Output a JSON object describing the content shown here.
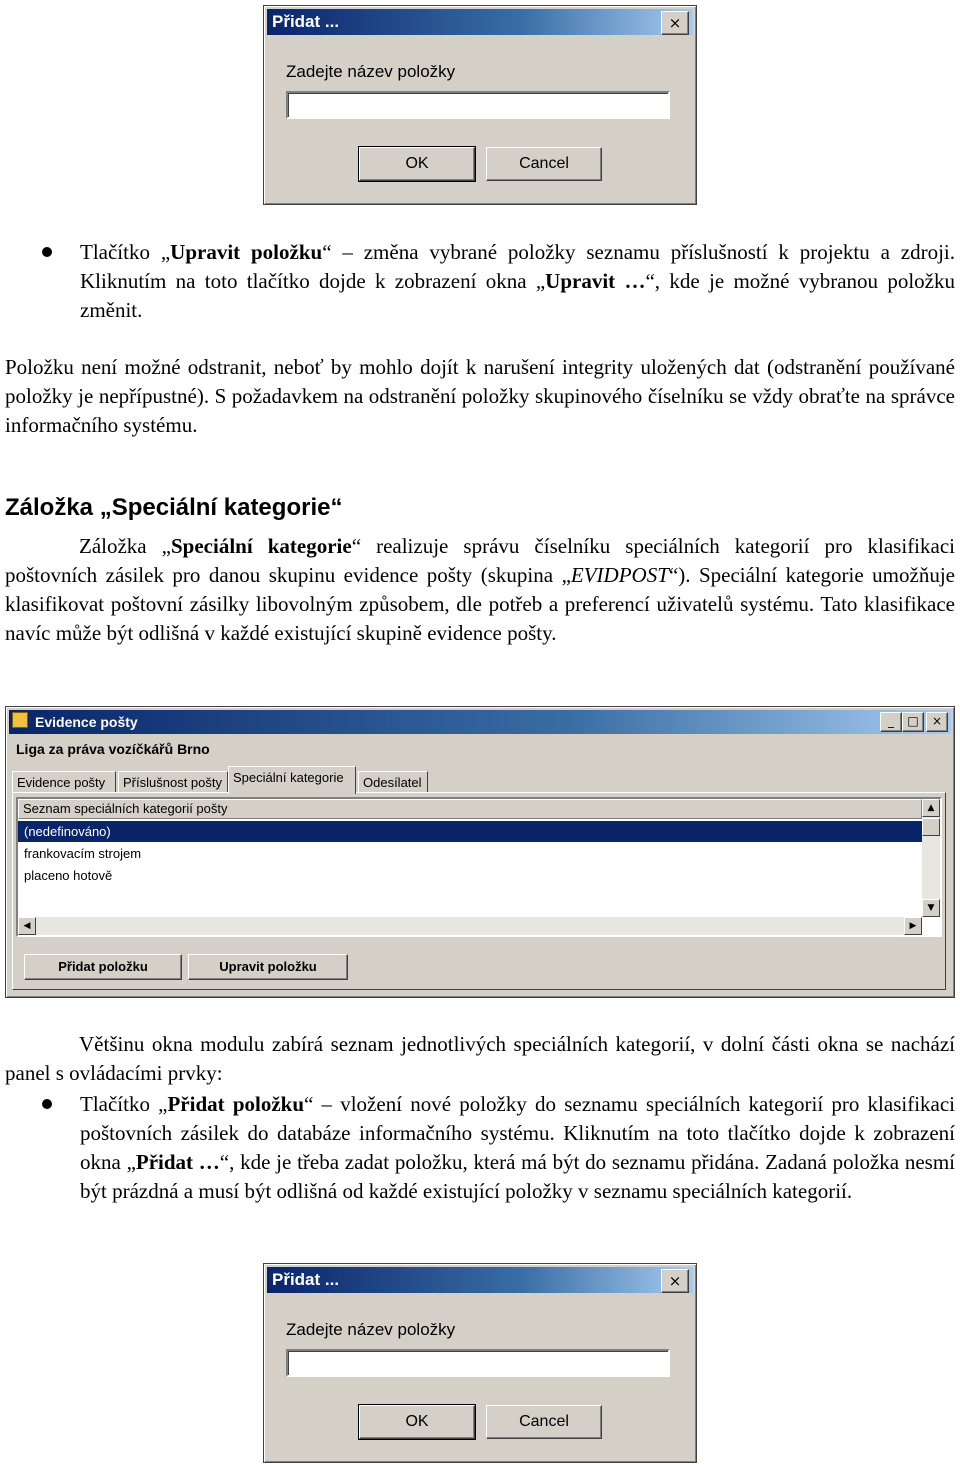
{
  "dialog_top": {
    "title": "Přidat ...",
    "prompt": "Zadejte název položky",
    "ok": "OK",
    "cancel": "Cancel",
    "close": "×"
  },
  "bullet1": {
    "pre": "Tlačítko „",
    "bold": "Upravit položku",
    "post": "“ – změna vybrané položky seznamu příslušností k projektu a zdroji. Kliknutím na toto tlačítko dojde k zobrazení okna „",
    "bold2": "Upravit …",
    "post2": "“, kde je možné vybranou položku změnit."
  },
  "para1": "Položku není možné odstranit, neboť by mohlo dojít k narušení integrity uložených dat (odstranění používané položky je nepřípustné). S požadavkem na odstranění položky skupinového číselníku se vždy obraťte na správce informačního systému.",
  "heading": "Záložka „Speciální kategorie“",
  "para2": {
    "pre": "Záložka „",
    "bold": "Speciální kategorie",
    "mid": "“ realizuje správu číselníku speciálních kategorií pro klasifikaci poštovních zásilek pro danou skupinu evidence pošty (skupina „",
    "italic": "EVIDPOST",
    "post": "“). Speciální kategorie umožňuje klasifikovat poštovní zásilky libovolným způsobem, dle potřeb a preferencí uživatelů systému. Tato klasifikace navíc může být odlišná v každé existující skupině evidence pošty."
  },
  "window": {
    "title": "Evidence pošty",
    "org": "Liga za práva vozíčkářů Brno",
    "tabs": [
      "Evidence pošty",
      "Příslušnost pošty",
      "Speciální kategorie",
      "Odesílatel"
    ],
    "active_tab": 2,
    "list_header": "Seznam speciálních kategorií pošty",
    "rows": [
      "(nedefinováno)",
      "frankovacím strojem",
      "placeno hotově"
    ],
    "selected_row": 0,
    "add_button": "Přidat položku",
    "edit_button": "Upravit položku",
    "min": "_",
    "max": "□",
    "close": "×"
  },
  "para3": "Většinu okna modulu zabírá seznam jednotlivých speciálních kategorií, v dolní části okna se nachází panel s ovládacími prvky:",
  "bullet2": {
    "pre": "Tlačítko „",
    "bold": "Přidat položku",
    "post": "“ – vložení nové položky do seznamu speciálních kategorií pro klasifikaci poštovních zásilek do databáze informačního systému. Kliknutím na toto tlačítko dojde k zobrazení okna „",
    "bold2": "Přidat …",
    "post2": "“, kde je třeba zadat položku, která má být do seznamu přidána. Zadaná položka nesmí být prázdná a musí být odlišná od každé existující položky v seznamu speciálních kategorií."
  },
  "dialog_bottom": {
    "title": "Přidat ...",
    "prompt": "Zadejte název položky",
    "ok": "OK",
    "cancel": "Cancel",
    "close": "×"
  }
}
